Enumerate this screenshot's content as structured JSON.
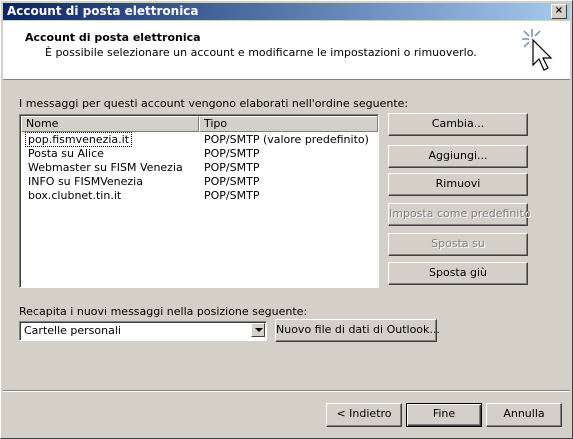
{
  "window": {
    "title": "Account di posta elettronica",
    "close_label": "×"
  },
  "header": {
    "title": "Account di posta elettronica",
    "subtitle": "È possibile selezionare un account e modificarne le impostazioni o rimuoverlo."
  },
  "accounts": {
    "label": "I messaggi per questi account vengono elaborati nell'ordine seguente:",
    "columns": {
      "name": "Nome",
      "type": "Tipo"
    },
    "rows": [
      {
        "name": "pop.fismvenezia.it",
        "type": "POP/SMTP (valore predefinito)",
        "selected": true
      },
      {
        "name": "Posta su Alice",
        "type": "POP/SMTP",
        "selected": false
      },
      {
        "name": "Webmaster su FISM Venezia",
        "type": "POP/SMTP",
        "selected": false
      },
      {
        "name": "INFO su FISMVenezia",
        "type": "POP/SMTP",
        "selected": false
      },
      {
        "name": "box.clubnet.tin.it",
        "type": "POP/SMTP",
        "selected": false
      }
    ]
  },
  "buttons": {
    "change": "Cambia...",
    "add": "Aggiungi...",
    "remove": "Rimuovi",
    "set_default": "Imposta come predefinito",
    "move_up": "Sposta su",
    "move_down": "Sposta giù"
  },
  "delivery": {
    "label": "Recapita i nuovi messaggi nella posizione seguente:",
    "selected": "Cartelle personali",
    "new_file_button": "Nuovo file di dati di Outlook..."
  },
  "footer": {
    "back": "< Indietro",
    "finish": "Fine",
    "cancel": "Annulla"
  }
}
